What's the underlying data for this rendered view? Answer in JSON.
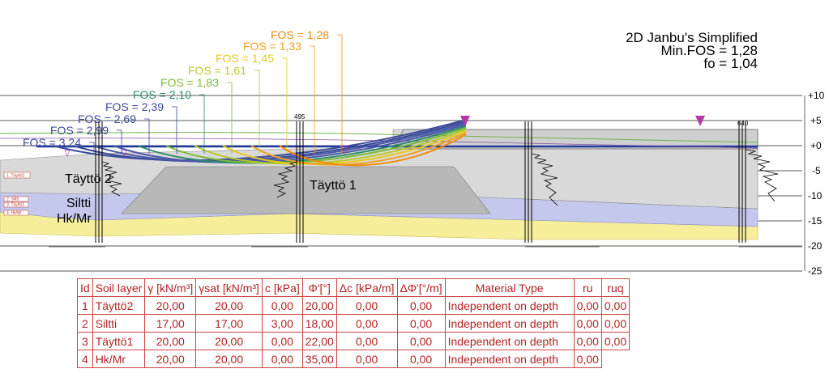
{
  "header": {
    "method": "2D Janbu's Simplified",
    "min_fos": "Min.FOS = 1,28",
    "fo": "fo = 1,04"
  },
  "fos_labels": [
    {
      "text": "FOS = 3,24",
      "color": "#3b4a9a"
    },
    {
      "text": "FOS = 2,99",
      "color": "#3b4a9a"
    },
    {
      "text": "FOS = 2,69",
      "color": "#3b4a9a"
    },
    {
      "text": "FOS = 2,39",
      "color": "#3b4a9a"
    },
    {
      "text": "FOS = 2,10",
      "color": "#2e8b6a"
    },
    {
      "text": "FOS = 1,83",
      "color": "#7cba3a"
    },
    {
      "text": "FOS = 1,61",
      "color": "#b9c92a"
    },
    {
      "text": "FOS = 1,45",
      "color": "#e8c81c"
    },
    {
      "text": "FOS = 1,33",
      "color": "#f0a020"
    },
    {
      "text": "FOS = 1,28",
      "color": "#f08c10"
    }
  ],
  "elevation_ticks": [
    "+10",
    "+5",
    "+0",
    "-5",
    "-10",
    "-15",
    "-20",
    "-25"
  ],
  "layer_labels": {
    "taytto2": "Täyttö 2",
    "siltti": "Siltti",
    "hkmr": "Hk/Mr",
    "taytto1": "Täyttö 1"
  },
  "section_labels": [
    "495",
    "640"
  ],
  "side_tags": [
    "1. Täyttö2",
    "2. Siltti",
    "3. Täyttö1",
    "4. Hk/Mr"
  ],
  "colors": {
    "taytto2_fill": "#d9d9d9",
    "taytto1_fill": "#b8b8b8",
    "siltti_fill": "#c4c8ec",
    "hkmr_fill": "#f7ee9c",
    "water_line": "#1f3a9a",
    "load_marker": "#b23aa8",
    "table_text": "#b22222"
  },
  "soil_table": {
    "headers": [
      "Id",
      "Soil layer",
      "γ [kN/m³]",
      "γsat [kN/m³]",
      "c [kPa]",
      "Φ'[°]",
      "Δc [kPa/m]",
      "ΔΦ'[°/m]",
      "Material Type",
      "ru",
      "ruq"
    ],
    "rows": [
      [
        "1",
        "Täyttö2",
        "20,00",
        "20,00",
        "0,00",
        "20,00",
        "0,00",
        "0,00",
        "Independent on depth",
        "0,00",
        "0,00"
      ],
      [
        "2",
        "Siltti",
        "17,00",
        "17,00",
        "3,00",
        "18,00",
        "0,00",
        "0,00",
        "Independent on depth",
        "0,00",
        "0,00"
      ],
      [
        "3",
        "Täyttö1",
        "20,00",
        "20,00",
        "0,00",
        "22,00",
        "0,00",
        "0,00",
        "Independent on depth",
        "0,00",
        "0,00"
      ],
      [
        "4",
        "Hk/Mr",
        "20,00",
        "20,00",
        "0,00",
        "35,00",
        "0,00",
        "0,00",
        "Independent on depth",
        "0,00",
        ""
      ]
    ]
  }
}
